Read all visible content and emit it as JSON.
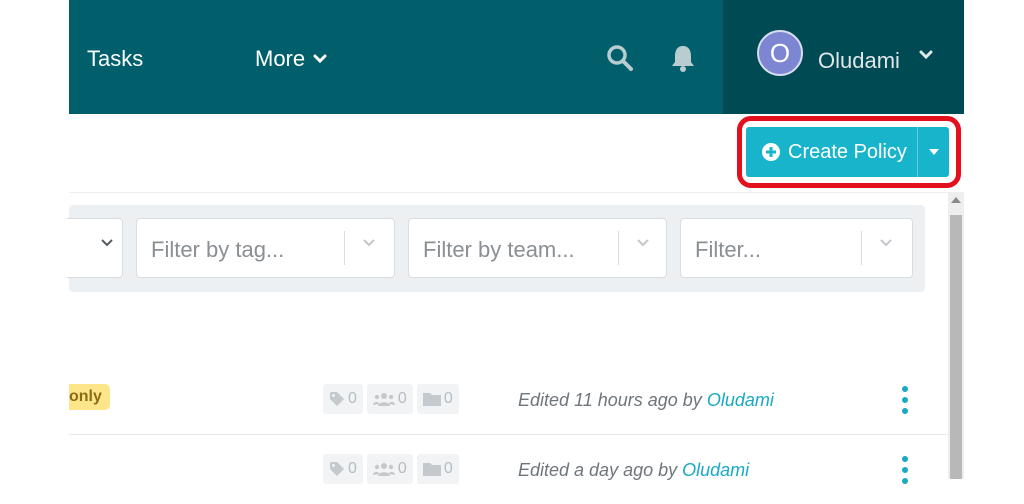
{
  "nav": {
    "tasks_label": "Tasks",
    "more_label": "More",
    "search_icon": "search-icon",
    "bell_icon": "bell-icon"
  },
  "user": {
    "avatar_initial": "O",
    "name": "Oludami"
  },
  "toolbar": {
    "create_label": "Create Policy"
  },
  "filters": {
    "tag_placeholder": "Filter by tag...",
    "team_placeholder": "Filter by team...",
    "other_placeholder": "Filter..."
  },
  "rows": [
    {
      "badge": "only",
      "tags": "0",
      "teams": "0",
      "folders": "0",
      "edited_prefix": "Edited 11 hours ago by ",
      "editor": "Oludami"
    },
    {
      "tags": "0",
      "teams": "0",
      "folders": "0",
      "edited_prefix": "Edited a day ago by ",
      "editor": "Oludami"
    }
  ],
  "colors": {
    "navbar": "#005f6b",
    "user_area": "#004a53",
    "accent": "#17b4cc",
    "highlight": "#e3101d",
    "link": "#1aa9c4"
  }
}
